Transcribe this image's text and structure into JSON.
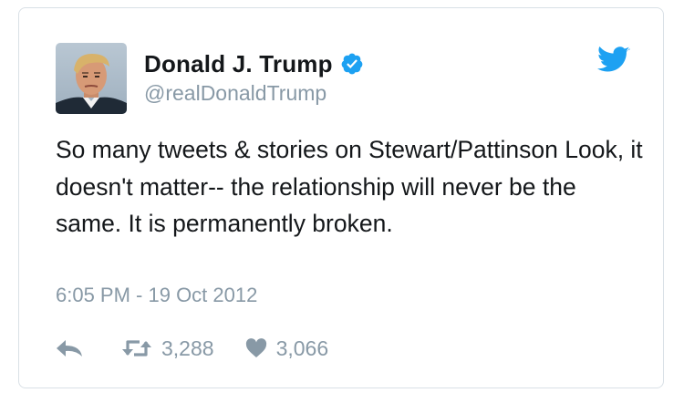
{
  "tweet": {
    "display_name": "Donald J. Trump",
    "handle": "@realDonaldTrump",
    "text": "So many tweets & stories on Stewart/Pattinson Look, it doesn't matter-- the relationship will never be the same. It is permanently broken.",
    "timestamp": "6:05 PM - 19 Oct 2012",
    "retweets": "3,288",
    "likes": "3,066",
    "verified": true
  },
  "icons": {
    "verified": "verified-badge-icon",
    "brand": "twitter-bird-icon",
    "reply": "reply-icon",
    "retweet": "retweet-icon",
    "like": "heart-icon"
  },
  "colors": {
    "brand_blue": "#1da1f2",
    "text": "#14171a",
    "muted": "#8899a6",
    "border": "#d9e0e6"
  }
}
